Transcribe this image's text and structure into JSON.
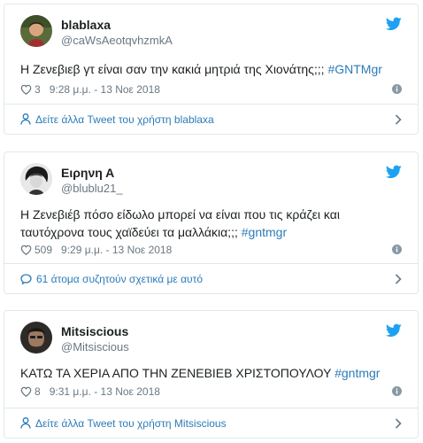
{
  "tweets": [
    {
      "display_name": "blablaxa",
      "screen_name": "@caWsAeotqvhzmkA",
      "text": "Η Ζενεβιεβ γτ είναι σαν την κακιά μητριά της Χιονάτης;;; ",
      "hashtag": "#GNTMgr",
      "likes": "3",
      "timestamp": "9:28 μ.μ. - 13 Νοε 2018",
      "footer_label": "Δείτε άλλα Tweet του χρήστη blablaxa",
      "icons": {
        "brand": "twitter-bird-icon",
        "like": "heart-icon",
        "info": "info-icon",
        "footer": "user-icon",
        "chevron": "chevron-right-icon"
      }
    },
    {
      "display_name": "Ειρηνη Α",
      "screen_name": "@blublu21_",
      "text_line1": "Η Ζενεβιέβ πόσο είδωλο μπορεί να είναι που τις κράζει και",
      "text_line2": "ταυτόχρονα τους χαϊδεύει τα μαλλάκια;;; ",
      "hashtag": "#gntmgr",
      "likes": "509",
      "timestamp": "9:29 μ.μ. - 13 Νοε 2018",
      "footer_label": "61 άτομα συζητούν σχετικά με αυτό",
      "icons": {
        "brand": "twitter-bird-icon",
        "like": "heart-icon",
        "info": "info-icon",
        "footer": "speech-bubble-icon",
        "chevron": "chevron-right-icon"
      }
    },
    {
      "display_name": "Mitsiscious",
      "screen_name": "@Mitsiscious",
      "text": "ΚΑΤΩ ΤΑ ΧΕΡΙΑ ΑΠΟ ΤΗΝ ΖΕΝΕΒΙΕΒ ΧΡΙΣΤΟΠΟΥΛΟΥ  ",
      "hashtag": "#gntmgr",
      "likes": "8",
      "timestamp": "9:31 μ.μ. - 13 Νοε 2018",
      "footer_label": "Δείτε άλλα Tweet του χρήστη Mitsiscious",
      "icons": {
        "brand": "twitter-bird-icon",
        "like": "heart-icon",
        "info": "info-icon",
        "footer": "user-icon",
        "chevron": "chevron-right-icon"
      }
    }
  ],
  "colors": {
    "link": "#2b7bb9",
    "muted": "#697882",
    "border": "#e1e8ed",
    "brand": "#1da1f2"
  }
}
